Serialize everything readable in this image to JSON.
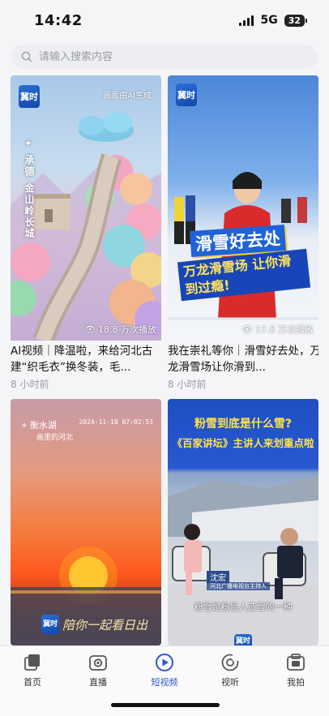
{
  "status": {
    "time": "14:42",
    "network": "5G",
    "battery": "32"
  },
  "search": {
    "placeholder": "请输入搜索内容"
  },
  "videos": [
    {
      "tag": "画面由AI生成",
      "side_text": "承德 金山岭长城",
      "title": "AI视频｜降温啦，来给河北古建“织毛衣”换冬装，毛...",
      "plays": "18.8 万次播放",
      "time": "8 小时前",
      "logo": "冀时"
    },
    {
      "headline": "滑雪好去处",
      "subline": "万龙滑雪场 让你滑到过瘾!",
      "title": "我在崇礼等你｜滑雪好去处，万龙滑雪场让你滑到...",
      "plays": "17.8 万次播放",
      "time": "8 小时前",
      "logo": "冀时"
    },
    {
      "place": "衡水湖",
      "sub_place": "画里的河北",
      "timestamp": "2024-11-18 07:02:53",
      "caption": "陪你一起看日出",
      "logo": "冀时"
    },
    {
      "question": "粉雪到底是什么雪?",
      "headline": "《百家讲坛》主讲人来划重点啦",
      "speaker": "沈宏",
      "speaker_title": "河北广播电视台主持人",
      "caption": "粉雪是粉是人造雪的一种",
      "logo": "冀时"
    }
  ],
  "tabs": [
    {
      "label": "首页",
      "icon": "home-icon"
    },
    {
      "label": "直播",
      "icon": "live-icon"
    },
    {
      "label": "短视频",
      "icon": "play-icon",
      "active": true
    },
    {
      "label": "视听",
      "icon": "listen-icon"
    },
    {
      "label": "我拍",
      "icon": "camera-icon"
    }
  ],
  "colors": {
    "accent": "#2b57d6",
    "background": "#f4f5f7"
  }
}
